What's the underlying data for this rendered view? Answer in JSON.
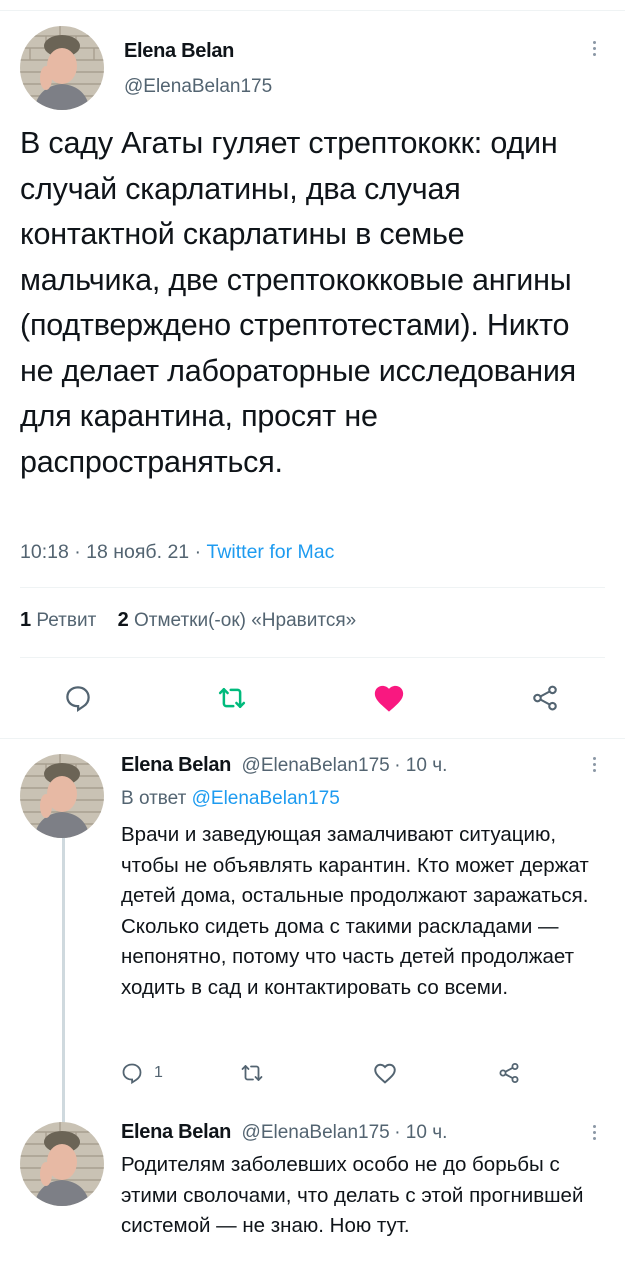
{
  "main_tweet": {
    "author_name": "Elena Belan",
    "author_handle": "@ElenaBelan175",
    "text": "В саду Агаты гуляет стрептококк: один случай скарлатины, два случая контактной скарлатины в семье мальчика, две стрептококковые ангины (подтверждено стрептотестами). Никто не делает лабораторные исследования для карантина, просят не распространяться.",
    "time": "10:18",
    "date": "18 нояб. 21",
    "source": "Twitter for Mac",
    "retweets_count": "1",
    "retweets_label": "Ретвит",
    "likes_count": "2",
    "likes_label": "Отметки(-ок) «Нравится»",
    "liked": true,
    "colors": {
      "like": "#f91880",
      "retweet": "#00ba7c",
      "link": "#1d9bf0"
    },
    "actions": [
      "reply-icon",
      "retweet-icon",
      "like-icon",
      "share-icon"
    ]
  },
  "replies": [
    {
      "author_name": "Elena Belan",
      "author_handle": "@ElenaBelan175",
      "age": "· 10 ч.",
      "in_reply_prefix": "В ответ",
      "in_reply_to": "@ElenaBelan175",
      "text": "Врачи и заведующая замалчивают ситуацию, чтобы не объявлять карантин. Кто может держат детей дома, остальные продолжают заражаться. Сколько сидеть дома с такими раскладами — непонятно, потому что часть детей продолжает ходить в сад и контактировать со всеми.",
      "reply_count": "1"
    },
    {
      "author_name": "Elena Belan",
      "author_handle": "@ElenaBelan175",
      "age": "· 10 ч.",
      "text": "Родителям заболевших особо не до борьбы с этими сволочами, что делать с этой прогнившей системой — не знаю. Ною тут."
    }
  ]
}
